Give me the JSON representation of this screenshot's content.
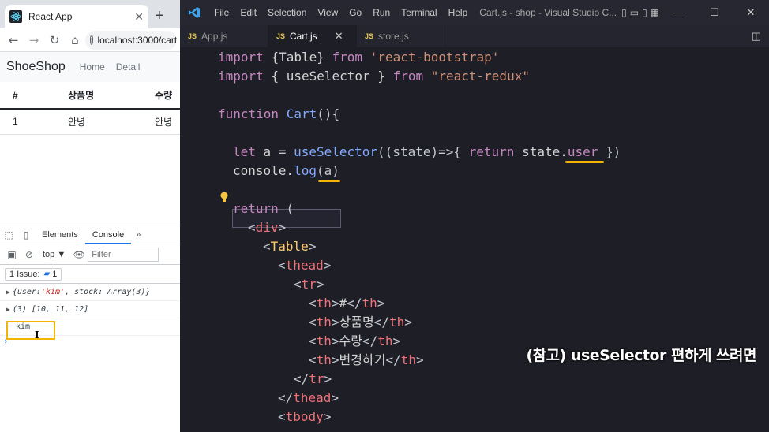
{
  "browser": {
    "tab": {
      "title": "React App",
      "close": "✕"
    },
    "new_tab": "+",
    "nav": {
      "back": "←",
      "forward": "→",
      "reload": "↻",
      "home": "⌂"
    },
    "address": {
      "info": "i",
      "url": "localhost:3000/cart"
    },
    "navbar": {
      "brand": "ShoeShop",
      "links": [
        "Home",
        "Detail"
      ]
    },
    "table": {
      "headers": [
        "#",
        "상품명",
        "수량"
      ],
      "rows": [
        [
          "1",
          "안녕",
          "안녕"
        ]
      ]
    }
  },
  "devtools": {
    "tabs": [
      "Elements",
      "Console"
    ],
    "more": "»",
    "toolbar": {
      "context": "top ▼",
      "filter_placeholder": "Filter"
    },
    "issues": {
      "label": "1 Issue:",
      "count": "1"
    },
    "console": [
      {
        "prefix": "{user: ",
        "str": "'kim'",
        "suffix": ", stock: Array(3)}"
      },
      {
        "text": "(3) [10, 11, 12]"
      },
      {
        "text": "kim"
      }
    ],
    "prompt": "›"
  },
  "vscode": {
    "menu": [
      "File",
      "Edit",
      "Selection",
      "View",
      "Go",
      "Run",
      "Terminal",
      "Help"
    ],
    "window_title": "Cart.js - shop - Visual Studio C...",
    "window_controls": [
      "—",
      "☐",
      "✕"
    ],
    "tabs": [
      {
        "badge": "JS",
        "name": "App.js"
      },
      {
        "badge": "JS",
        "name": "Cart.js",
        "close": "✕"
      },
      {
        "badge": "JS",
        "name": "store.js"
      }
    ],
    "code": {
      "l1": [
        "import ",
        "{Table}",
        " from ",
        "'react-bootstrap'"
      ],
      "l2": [
        "import ",
        "{ useSelector }",
        " from ",
        "\"react-redux\""
      ],
      "l3": [
        "function ",
        "Cart",
        "(){"
      ],
      "l4": [
        "let ",
        "a",
        " = ",
        "useSelector",
        "((state)=>{ ",
        "return ",
        "state.",
        "user",
        " })"
      ],
      "l5": [
        "console.",
        "log",
        "(a)"
      ],
      "l6": [
        "return ",
        "("
      ],
      "l7": [
        "<",
        "div",
        ">"
      ],
      "l8": [
        "<",
        "Table",
        ">"
      ],
      "l9": [
        "<",
        "thead",
        ">"
      ],
      "l10": [
        "<",
        "tr",
        ">"
      ],
      "l11": [
        "<",
        "th",
        ">",
        "#",
        "</",
        "th",
        ">"
      ],
      "l12": [
        "<",
        "th",
        ">",
        "상품명",
        "</",
        "th",
        ">"
      ],
      "l13": [
        "<",
        "th",
        ">",
        "수량",
        "</",
        "th",
        ">"
      ],
      "l14": [
        "<",
        "th",
        ">",
        "변경하기",
        "</",
        "th",
        ">"
      ],
      "l15": [
        "</",
        "tr",
        ">"
      ],
      "l16": [
        "</",
        "thead",
        ">"
      ],
      "l17": [
        "<",
        "tbody",
        ">"
      ]
    },
    "caption": "(참고) useSelector 편하게 쓰려면"
  },
  "colors": {
    "highlight": "#f5b400",
    "editor_bg": "#1e1e26",
    "keyword": "#c586c0",
    "function": "#82aaff",
    "string": "#ce9178",
    "tag": "#f07178"
  }
}
